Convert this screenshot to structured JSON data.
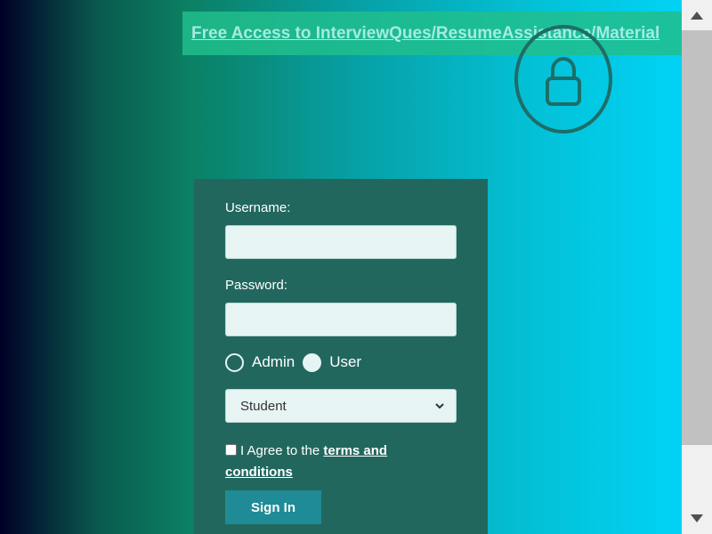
{
  "banner": {
    "link_text": "Free Access to InterviewQues/ResumeAssistance/Material"
  },
  "icons": {
    "lock": "lock-icon",
    "dropdown": "chevron-down-icon"
  },
  "login_form": {
    "username_label": "Username:",
    "username_value": "",
    "password_label": "Password:",
    "password_value": "",
    "roles": [
      {
        "label": "Admin",
        "selected": false
      },
      {
        "label": "User",
        "selected": false
      }
    ],
    "role_select_value": "Student",
    "agree_prefix": "I Agree to the ",
    "terms_link_text": "terms and conditions",
    "agree_checked": false,
    "sign_in_label": "Sign In"
  },
  "colors": {
    "card_bg": "#22675e",
    "banner_bg": "#21be8c",
    "button_bg": "#1f8b96",
    "link_color": "#a4ebe2"
  }
}
